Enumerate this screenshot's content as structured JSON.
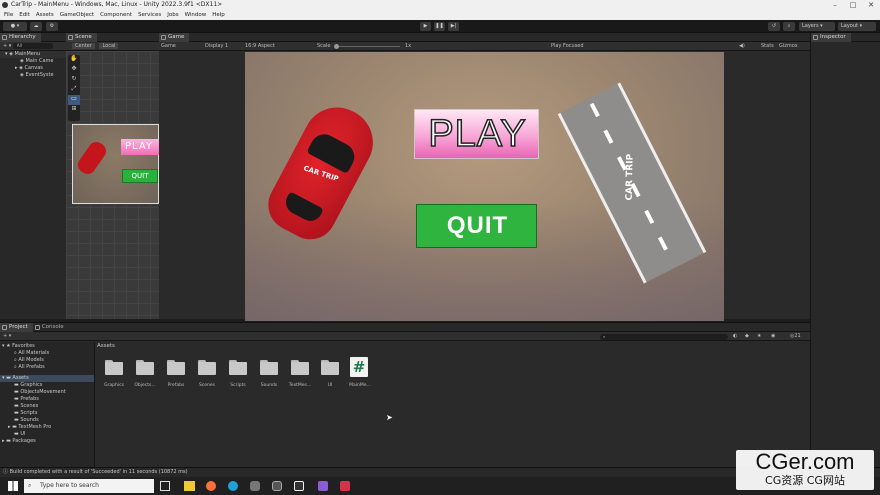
{
  "window": {
    "title": "CarTrip - MainMenu - Windows, Mac, Linux - Unity 2022.3.9f1 <DX11>"
  },
  "menu": [
    "File",
    "Edit",
    "Assets",
    "GameObject",
    "Component",
    "Services",
    "Jobs",
    "Window",
    "Help"
  ],
  "toolbar": {
    "layers": "Layers",
    "layout": "Layout"
  },
  "hierarchy": {
    "tab": "Hierarchy",
    "search": "All",
    "items": [
      "MainMenu",
      "Main Came",
      "Canvas",
      "EventSyste"
    ]
  },
  "scene": {
    "tab": "Scene",
    "pivot": "Center",
    "space": "Local",
    "play": "PLAY",
    "quit": "QUIT"
  },
  "game": {
    "tab": "Game",
    "mode": "Game",
    "display": "Display 1",
    "aspect": "16:9 Aspect",
    "scale_label": "Scale",
    "scale_value": "1x",
    "play_focused": "Play Focused",
    "stats": "Stats",
    "gizmos": "Gizmos",
    "play_label": "PLAY",
    "quit_label": "QUIT",
    "road_text": "CAR TRIP",
    "car_text": "CAR TRIP"
  },
  "inspector": {
    "tab": "Inspector"
  },
  "project": {
    "tab": "Project",
    "console_tab": "Console",
    "count": "21",
    "breadcrumb": "Assets",
    "favorites": {
      "label": "Favorites",
      "items": [
        "All Materials",
        "All Models",
        "All Prefabs"
      ]
    },
    "assets": {
      "label": "Assets",
      "items": [
        "Graphics",
        "ObjectsMovement",
        "Prefabs",
        "Scenes",
        "Scripts",
        "Sounds",
        "TextMesh Pro",
        "UI"
      ]
    },
    "packages": "Packages",
    "grid": [
      "Graphics",
      "Objects...",
      "Prefabs",
      "Scenes",
      "Scripts",
      "Sounds",
      "TextMes...",
      "UI",
      "MainMe..."
    ]
  },
  "status": {
    "text": "Build completed with a result of 'Succeeded' in 11 seconds (10872 ms)"
  },
  "taskbar": {
    "search": "Type here to search"
  },
  "watermark": {
    "text": "CGer.com",
    "sub": "CG资源 CG网站"
  }
}
